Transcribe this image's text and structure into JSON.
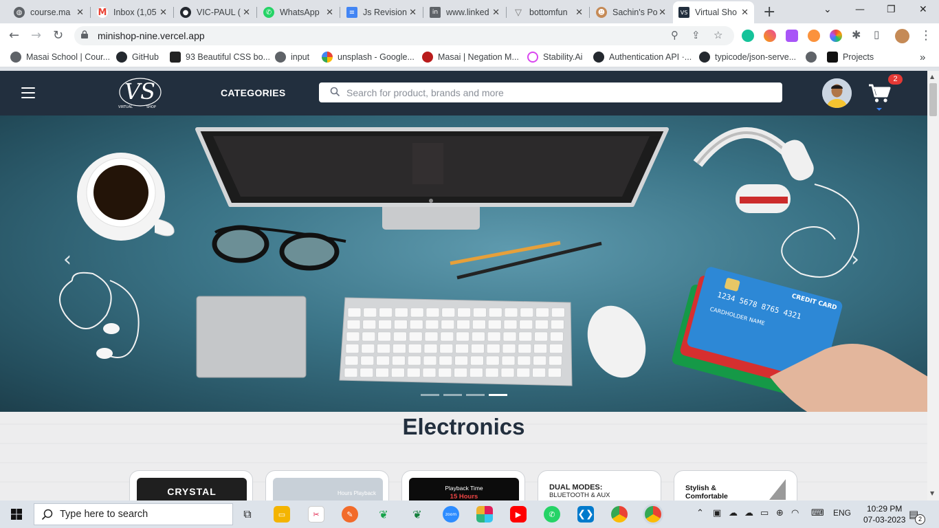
{
  "browser": {
    "tabs": [
      {
        "title": "course.ma",
        "icon": "globe-icon",
        "color": "#5f6368"
      },
      {
        "title": "Inbox (1,05",
        "icon": "gmail-icon",
        "color": "#ea4335"
      },
      {
        "title": "VIC-PAUL (",
        "icon": "github-icon",
        "color": "#24292f"
      },
      {
        "title": "WhatsApp",
        "icon": "whatsapp-icon",
        "color": "#25d366"
      },
      {
        "title": "Js Revision",
        "icon": "docs-icon",
        "color": "#4285f4"
      },
      {
        "title": "www.linked",
        "icon": "linkedin-icon",
        "color": "#5f6368"
      },
      {
        "title": "bottomfun",
        "icon": "triangle-icon",
        "color": "#777"
      },
      {
        "title": "Sachin's Po",
        "icon": "person-icon",
        "color": "#c58a56"
      },
      {
        "title": "Virtual Sho",
        "icon": "vs-icon",
        "color": "#222f3e"
      }
    ],
    "url": "minishop-nine.vercel.app",
    "bookmarks": [
      {
        "label": "Masai School | Cour...",
        "color": "#5f6368"
      },
      {
        "label": "GitHub",
        "color": "#24292f"
      },
      {
        "label": "93 Beautiful CSS bo...",
        "color": "#222"
      },
      {
        "label": "input",
        "color": "#5f6368"
      },
      {
        "label": "unsplash - Google...",
        "color": "#4285f4"
      },
      {
        "label": "Masai | Negation M...",
        "color": "#b91c1c"
      },
      {
        "label": "Stability.Ai",
        "color": "#d946ef"
      },
      {
        "label": "Authentication API ·...",
        "color": "#24292f"
      },
      {
        "label": "typicode/json-serve...",
        "color": "#24292f"
      },
      {
        "label": "",
        "color": "#5f6368"
      },
      {
        "label": "Projects",
        "color": "#111"
      }
    ],
    "more_bookmarks": "»"
  },
  "site": {
    "logo_text": "VS",
    "logo_sub_left": "VIRTUAL",
    "logo_sub_right": "SHOP",
    "categories_label": "CATEGORIES",
    "search_placeholder": "Search for product, brands and more",
    "cart_count": "2",
    "header_color": "#222f3e"
  },
  "hero": {
    "slide_count": 4,
    "active_slide": 4,
    "card_text_1": "1234 5678 8765 4321",
    "card_text_2": "CREDIT CARD",
    "card_text_3": "CARDHOLDER NAME"
  },
  "section": {
    "title": "Electronics",
    "cards": [
      {
        "text": "CRYSTAL",
        "bg": "#1f1f1f",
        "fg": "#ffffff"
      },
      {
        "text": "Hours Playback",
        "bg": "#c8d0d8",
        "fg": "#ffffff"
      },
      {
        "text": "Playback Time",
        "sub": "15 Hours",
        "bg": "#0c0c0c",
        "fg": "#ffffff"
      },
      {
        "text": "DUAL MODES:",
        "sub": "BLUETOOTH & AUX",
        "bg": "#ffffff",
        "fg": "#222222"
      },
      {
        "text": "Stylish &",
        "sub": "Comfortable",
        "bg": "#ffffff",
        "fg": "#111111"
      }
    ]
  },
  "taskbar": {
    "search_label": "Type here to search",
    "lang": "ENG",
    "time": "10:29 PM",
    "date": "07-03-2023",
    "notifications": "2"
  }
}
